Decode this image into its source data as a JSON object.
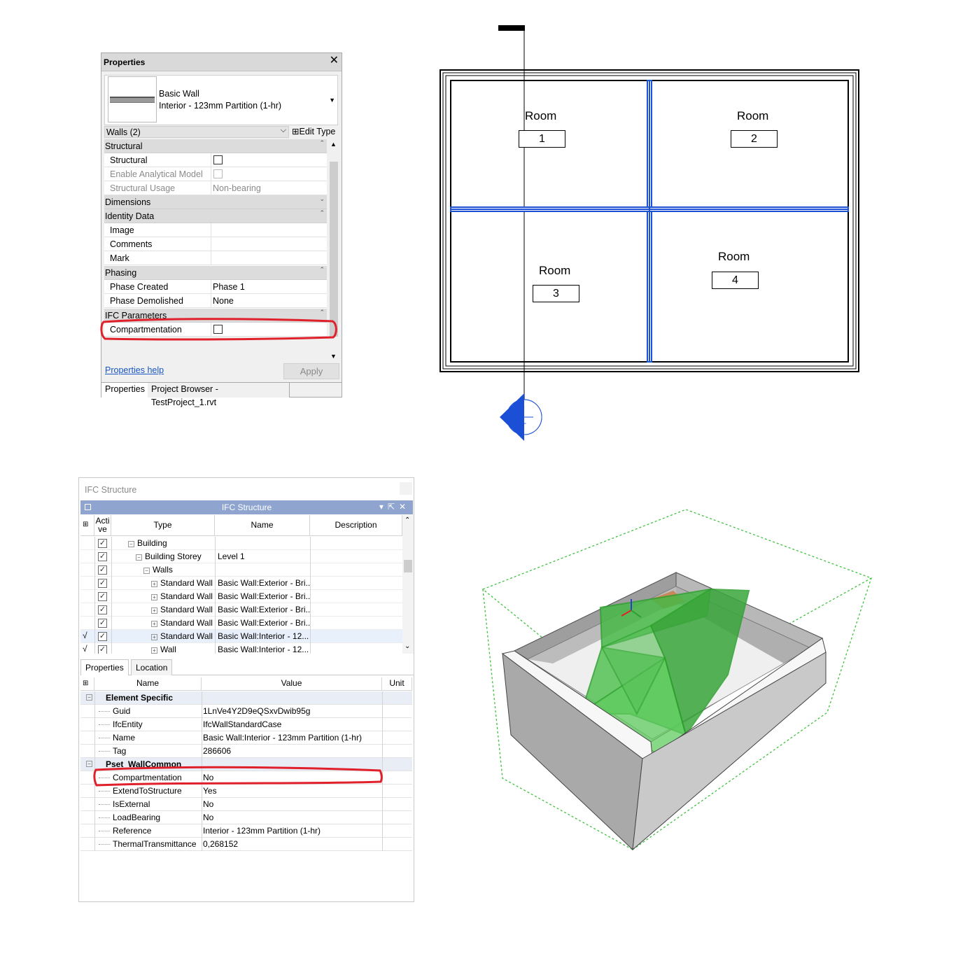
{
  "properties_panel": {
    "title": "Properties",
    "close_glyph": "✕",
    "type_family": "Basic Wall",
    "type_name": "Interior - 123mm Partition (1-hr)",
    "instance_filter": "Walls (2)",
    "edit_type_label": "Edit Type",
    "categories": {
      "structural": "Structural",
      "dimensions": "Dimensions",
      "identity": "Identity Data",
      "phasing": "Phasing",
      "ifc": "IFC Parameters"
    },
    "params": {
      "structural": {
        "name": "Structural",
        "checked": false
      },
      "analytical": {
        "name": "Enable Analytical Model",
        "checked": false,
        "disabled": true
      },
      "usage": {
        "name": "Structural Usage",
        "value": "Non-bearing"
      },
      "image": {
        "name": "Image",
        "value": ""
      },
      "comments": {
        "name": "Comments",
        "value": ""
      },
      "mark": {
        "name": "Mark",
        "value": ""
      },
      "phase_created": {
        "name": "Phase Created",
        "value": "Phase 1"
      },
      "phase_demolished": {
        "name": "Phase Demolished",
        "value": "None"
      },
      "compartmentation": {
        "name": "Compartmentation",
        "checked": false
      }
    },
    "help_link": "Properties help",
    "apply_label": "Apply",
    "tabs": [
      "Properties",
      "Project Browser - TestProject_1.rvt"
    ]
  },
  "plan_view": {
    "rooms": [
      {
        "label": "Room",
        "number": "1"
      },
      {
        "label": "Room",
        "number": "2"
      },
      {
        "label": "Room",
        "number": "3"
      },
      {
        "label": "Room",
        "number": "4"
      }
    ],
    "section_marker_top": "-",
    "section_marker_bottom": "---",
    "selected_wall_color": "#1a4fd6"
  },
  "ifc_structure": {
    "window_title": "IFC Structure",
    "panel_header": "IFC Structure",
    "columns": [
      "Acti ve",
      "Type",
      "Name",
      "Description"
    ],
    "rows": [
      {
        "active": "",
        "checked": true,
        "indent": 1,
        "expander": "−",
        "type": "Building",
        "name": ""
      },
      {
        "active": "",
        "checked": true,
        "indent": 2,
        "expander": "−",
        "type": "Building Storey",
        "name": "Level 1"
      },
      {
        "active": "",
        "checked": true,
        "indent": 3,
        "expander": "−",
        "type": "Walls",
        "name": ""
      },
      {
        "active": "",
        "checked": true,
        "indent": 4,
        "expander": "+",
        "type": "Standard Wall",
        "name": "Basic Wall:Exterior - Bri..."
      },
      {
        "active": "",
        "checked": true,
        "indent": 4,
        "expander": "+",
        "type": "Standard Wall",
        "name": "Basic Wall:Exterior - Bri..."
      },
      {
        "active": "",
        "checked": true,
        "indent": 4,
        "expander": "+",
        "type": "Standard Wall",
        "name": "Basic Wall:Exterior - Bri..."
      },
      {
        "active": "",
        "checked": true,
        "indent": 4,
        "expander": "+",
        "type": "Standard Wall",
        "name": "Basic Wall:Exterior - Bri..."
      },
      {
        "active": "√",
        "checked": true,
        "indent": 4,
        "expander": "+",
        "type": "Standard Wall",
        "name": "Basic Wall:Interior - 12...",
        "selected": true
      },
      {
        "active": "√",
        "checked": true,
        "indent": 4,
        "expander": "+",
        "type": "Wall",
        "name": "Basic Wall:Interior - 12..."
      }
    ],
    "prop_tabs": [
      "Properties",
      "Location"
    ],
    "prop_columns": [
      "Name",
      "Value",
      "Unit"
    ],
    "prop_rows": [
      {
        "group": true,
        "name": "Element Specific"
      },
      {
        "name": "Guid",
        "value": "1LnVe4Y2D9eQSxvDwib95g"
      },
      {
        "name": "IfcEntity",
        "value": "IfcWallStandardCase"
      },
      {
        "name": "Name",
        "value": "Basic Wall:Interior - 123mm Partition (1-hr)"
      },
      {
        "name": "Tag",
        "value": "286606"
      },
      {
        "group": true,
        "name": "Pset_WallCommon"
      },
      {
        "name": "Compartmentation",
        "value": "No"
      },
      {
        "name": "ExtendToStructure",
        "value": "Yes"
      },
      {
        "name": "IsExternal",
        "value": "No"
      },
      {
        "name": "LoadBearing",
        "value": "No"
      },
      {
        "name": "Reference",
        "value": "Interior - 123mm Partition (1-hr)"
      },
      {
        "name": "ThermalTransmittance",
        "value": "0,268152"
      }
    ]
  },
  "colors": {
    "highlight_red": "#e0202a",
    "header_blue": "#8fa5cf",
    "selection_green": "#3fc13f"
  }
}
